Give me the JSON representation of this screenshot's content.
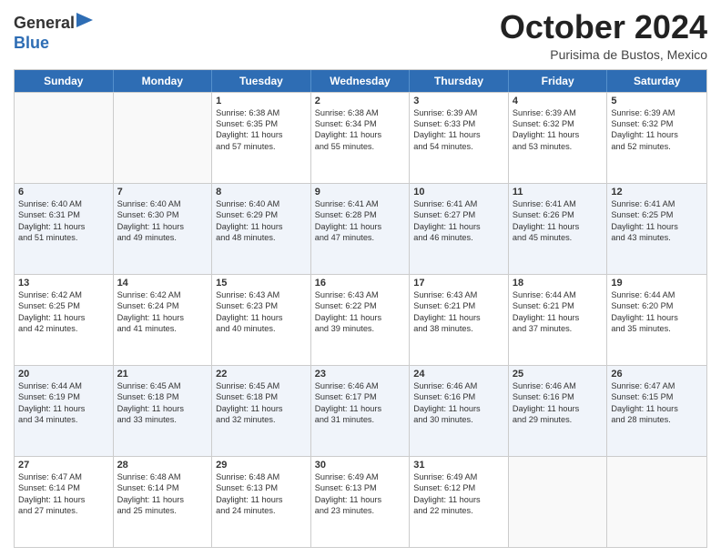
{
  "header": {
    "logo_line1": "General",
    "logo_line2": "Blue",
    "month": "October 2024",
    "location": "Purisima de Bustos, Mexico"
  },
  "days_of_week": [
    "Sunday",
    "Monday",
    "Tuesday",
    "Wednesday",
    "Thursday",
    "Friday",
    "Saturday"
  ],
  "weeks": [
    [
      {
        "day": "",
        "lines": []
      },
      {
        "day": "",
        "lines": []
      },
      {
        "day": "1",
        "lines": [
          "Sunrise: 6:38 AM",
          "Sunset: 6:35 PM",
          "Daylight: 11 hours",
          "and 57 minutes."
        ]
      },
      {
        "day": "2",
        "lines": [
          "Sunrise: 6:38 AM",
          "Sunset: 6:34 PM",
          "Daylight: 11 hours",
          "and 55 minutes."
        ]
      },
      {
        "day": "3",
        "lines": [
          "Sunrise: 6:39 AM",
          "Sunset: 6:33 PM",
          "Daylight: 11 hours",
          "and 54 minutes."
        ]
      },
      {
        "day": "4",
        "lines": [
          "Sunrise: 6:39 AM",
          "Sunset: 6:32 PM",
          "Daylight: 11 hours",
          "and 53 minutes."
        ]
      },
      {
        "day": "5",
        "lines": [
          "Sunrise: 6:39 AM",
          "Sunset: 6:32 PM",
          "Daylight: 11 hours",
          "and 52 minutes."
        ]
      }
    ],
    [
      {
        "day": "6",
        "lines": [
          "Sunrise: 6:40 AM",
          "Sunset: 6:31 PM",
          "Daylight: 11 hours",
          "and 51 minutes."
        ]
      },
      {
        "day": "7",
        "lines": [
          "Sunrise: 6:40 AM",
          "Sunset: 6:30 PM",
          "Daylight: 11 hours",
          "and 49 minutes."
        ]
      },
      {
        "day": "8",
        "lines": [
          "Sunrise: 6:40 AM",
          "Sunset: 6:29 PM",
          "Daylight: 11 hours",
          "and 48 minutes."
        ]
      },
      {
        "day": "9",
        "lines": [
          "Sunrise: 6:41 AM",
          "Sunset: 6:28 PM",
          "Daylight: 11 hours",
          "and 47 minutes."
        ]
      },
      {
        "day": "10",
        "lines": [
          "Sunrise: 6:41 AM",
          "Sunset: 6:27 PM",
          "Daylight: 11 hours",
          "and 46 minutes."
        ]
      },
      {
        "day": "11",
        "lines": [
          "Sunrise: 6:41 AM",
          "Sunset: 6:26 PM",
          "Daylight: 11 hours",
          "and 45 minutes."
        ]
      },
      {
        "day": "12",
        "lines": [
          "Sunrise: 6:41 AM",
          "Sunset: 6:25 PM",
          "Daylight: 11 hours",
          "and 43 minutes."
        ]
      }
    ],
    [
      {
        "day": "13",
        "lines": [
          "Sunrise: 6:42 AM",
          "Sunset: 6:25 PM",
          "Daylight: 11 hours",
          "and 42 minutes."
        ]
      },
      {
        "day": "14",
        "lines": [
          "Sunrise: 6:42 AM",
          "Sunset: 6:24 PM",
          "Daylight: 11 hours",
          "and 41 minutes."
        ]
      },
      {
        "day": "15",
        "lines": [
          "Sunrise: 6:43 AM",
          "Sunset: 6:23 PM",
          "Daylight: 11 hours",
          "and 40 minutes."
        ]
      },
      {
        "day": "16",
        "lines": [
          "Sunrise: 6:43 AM",
          "Sunset: 6:22 PM",
          "Daylight: 11 hours",
          "and 39 minutes."
        ]
      },
      {
        "day": "17",
        "lines": [
          "Sunrise: 6:43 AM",
          "Sunset: 6:21 PM",
          "Daylight: 11 hours",
          "and 38 minutes."
        ]
      },
      {
        "day": "18",
        "lines": [
          "Sunrise: 6:44 AM",
          "Sunset: 6:21 PM",
          "Daylight: 11 hours",
          "and 37 minutes."
        ]
      },
      {
        "day": "19",
        "lines": [
          "Sunrise: 6:44 AM",
          "Sunset: 6:20 PM",
          "Daylight: 11 hours",
          "and 35 minutes."
        ]
      }
    ],
    [
      {
        "day": "20",
        "lines": [
          "Sunrise: 6:44 AM",
          "Sunset: 6:19 PM",
          "Daylight: 11 hours",
          "and 34 minutes."
        ]
      },
      {
        "day": "21",
        "lines": [
          "Sunrise: 6:45 AM",
          "Sunset: 6:18 PM",
          "Daylight: 11 hours",
          "and 33 minutes."
        ]
      },
      {
        "day": "22",
        "lines": [
          "Sunrise: 6:45 AM",
          "Sunset: 6:18 PM",
          "Daylight: 11 hours",
          "and 32 minutes."
        ]
      },
      {
        "day": "23",
        "lines": [
          "Sunrise: 6:46 AM",
          "Sunset: 6:17 PM",
          "Daylight: 11 hours",
          "and 31 minutes."
        ]
      },
      {
        "day": "24",
        "lines": [
          "Sunrise: 6:46 AM",
          "Sunset: 6:16 PM",
          "Daylight: 11 hours",
          "and 30 minutes."
        ]
      },
      {
        "day": "25",
        "lines": [
          "Sunrise: 6:46 AM",
          "Sunset: 6:16 PM",
          "Daylight: 11 hours",
          "and 29 minutes."
        ]
      },
      {
        "day": "26",
        "lines": [
          "Sunrise: 6:47 AM",
          "Sunset: 6:15 PM",
          "Daylight: 11 hours",
          "and 28 minutes."
        ]
      }
    ],
    [
      {
        "day": "27",
        "lines": [
          "Sunrise: 6:47 AM",
          "Sunset: 6:14 PM",
          "Daylight: 11 hours",
          "and 27 minutes."
        ]
      },
      {
        "day": "28",
        "lines": [
          "Sunrise: 6:48 AM",
          "Sunset: 6:14 PM",
          "Daylight: 11 hours",
          "and 25 minutes."
        ]
      },
      {
        "day": "29",
        "lines": [
          "Sunrise: 6:48 AM",
          "Sunset: 6:13 PM",
          "Daylight: 11 hours",
          "and 24 minutes."
        ]
      },
      {
        "day": "30",
        "lines": [
          "Sunrise: 6:49 AM",
          "Sunset: 6:13 PM",
          "Daylight: 11 hours",
          "and 23 minutes."
        ]
      },
      {
        "day": "31",
        "lines": [
          "Sunrise: 6:49 AM",
          "Sunset: 6:12 PM",
          "Daylight: 11 hours",
          "and 22 minutes."
        ]
      },
      {
        "day": "",
        "lines": []
      },
      {
        "day": "",
        "lines": []
      }
    ]
  ]
}
